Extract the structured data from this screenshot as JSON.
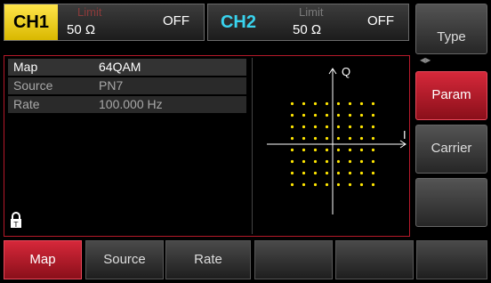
{
  "channels": [
    {
      "name": "CH1",
      "limit_label": "Limit",
      "impedance": "50 Ω",
      "state": "OFF",
      "color": "#ffd400"
    },
    {
      "name": "CH2",
      "limit_label": "Limit",
      "impedance": "50 Ω",
      "state": "OFF",
      "color": "#39d3ee"
    }
  ],
  "params": [
    {
      "label": "Map",
      "value": "64QAM"
    },
    {
      "label": "Source",
      "value": "PN7"
    },
    {
      "label": "Rate",
      "value": "100.000 Hz"
    }
  ],
  "constellation": {
    "q_label": "Q",
    "i_label": "I",
    "grid": 8,
    "dot_color": "#ffe600"
  },
  "side_menu": [
    "Type",
    "Param",
    "Carrier",
    ""
  ],
  "bottom_tabs": [
    "Map",
    "Source",
    "Rate",
    "",
    "",
    ""
  ],
  "accent": "#c81e30",
  "icons": {
    "lock": "lock-icon"
  }
}
